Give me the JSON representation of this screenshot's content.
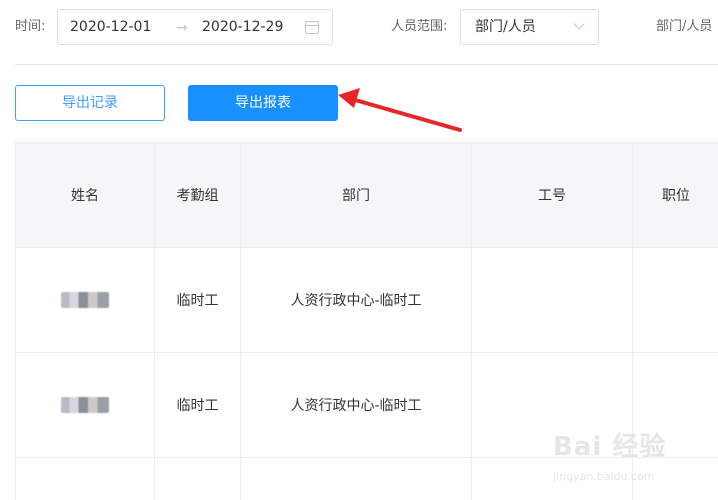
{
  "filters": {
    "time_label": "时间:",
    "date_start": "2020-12-01",
    "date_separator": "→",
    "date_end": "2020-12-29",
    "range_label": "人员范围:",
    "range_value": "部门/人员",
    "range_truncated": "部门/人员"
  },
  "actions": {
    "export_records": "导出记录",
    "export_report": "导出报表"
  },
  "table": {
    "headers": [
      "姓名",
      "考勤组",
      "部门",
      "工号",
      "职位"
    ],
    "rows": [
      {
        "group": "临时工",
        "department": "人资行政中心-临时工",
        "employee_id": "",
        "position": ""
      },
      {
        "group": "临时工",
        "department": "人资行政中心-临时工",
        "employee_id": "",
        "position": ""
      }
    ]
  },
  "watermark": {
    "logo_text": "Bai 经验",
    "url": "jingyan.baidu.com"
  },
  "colors": {
    "primary": "#1890ff",
    "outline": "#409eff",
    "arrow": "#e8262a",
    "header_bg": "#f5f6f7"
  }
}
